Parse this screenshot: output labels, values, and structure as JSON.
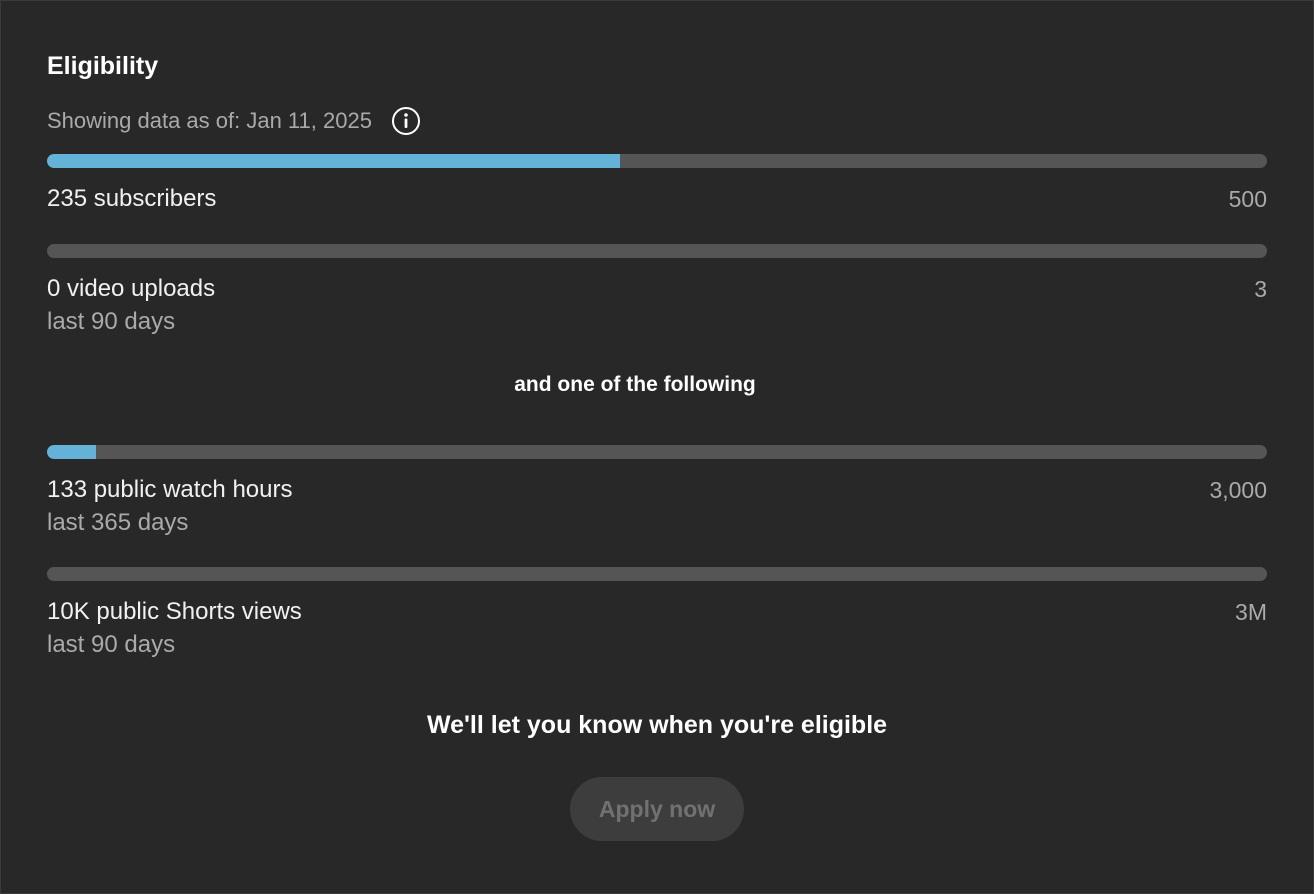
{
  "card": {
    "title": "Eligibility",
    "as_of": "Showing data as of: Jan 11, 2025"
  },
  "colors": {
    "progress": "#65b2d9",
    "track": "#555555",
    "background": "#282828"
  },
  "icons": {
    "info": "info-circle-icon"
  },
  "metrics": [
    {
      "label": "235 subscribers",
      "sublabel": "",
      "target": "500",
      "progress": 0.47
    },
    {
      "label": "0 video uploads",
      "sublabel": "last 90 days",
      "target": "3",
      "progress": 0
    }
  ],
  "divider_text": "and one of the following",
  "alt_metrics": [
    {
      "label": "133 public watch hours",
      "sublabel": "last 365 days",
      "target": "3,000",
      "progress": 0.04
    },
    {
      "label": "10K public Shorts views",
      "sublabel": "last 90 days",
      "target": "3M",
      "progress": 0
    }
  ],
  "notice": "We'll let you know when you're eligible",
  "apply_button": {
    "label": "Apply now",
    "disabled": true
  }
}
